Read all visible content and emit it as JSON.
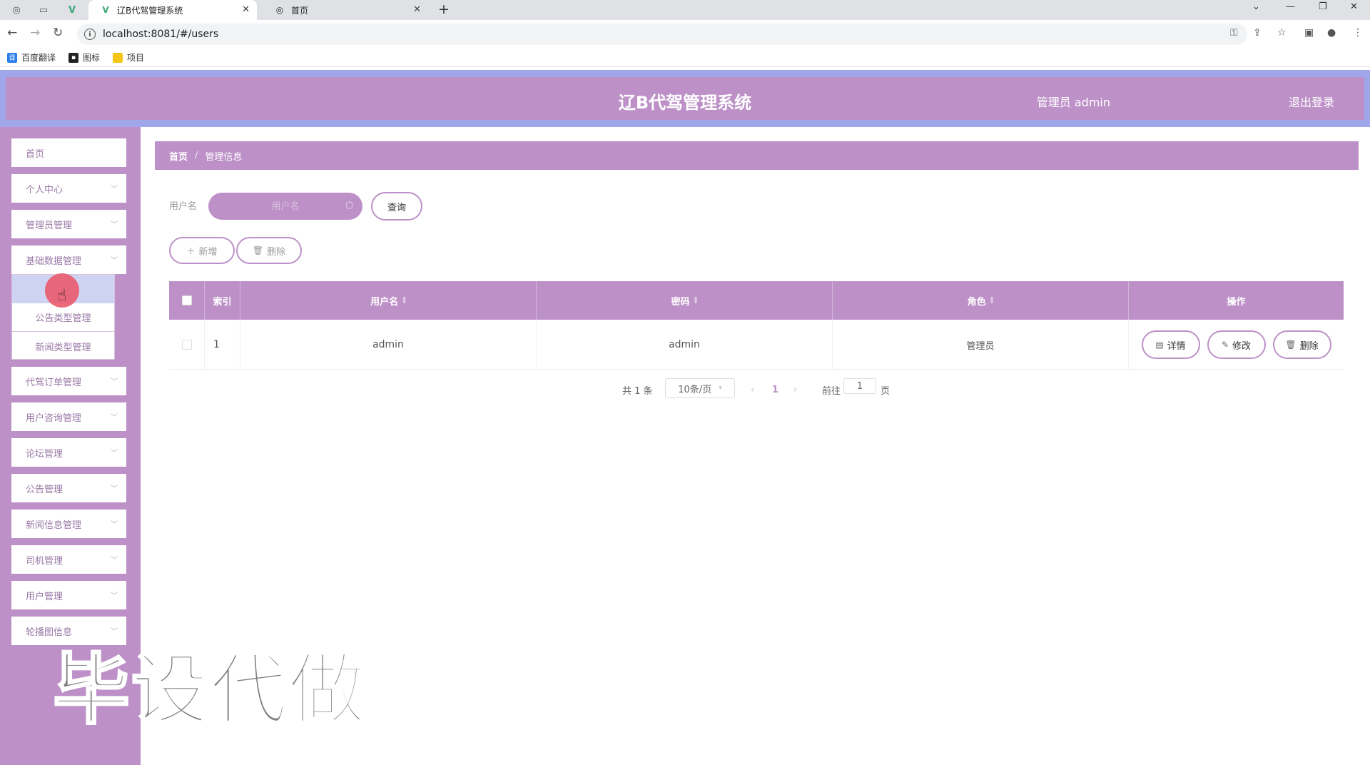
{
  "browser": {
    "tabs": [
      {
        "label": "辽B代驾管理系统",
        "active": true
      },
      {
        "label": "首页",
        "active": false
      }
    ],
    "url": "localhost:8081/#/users",
    "bookmarks": [
      "百度翻译",
      "图标",
      "项目"
    ]
  },
  "header": {
    "title": "辽B代驾管理系统",
    "user": "管理员 admin",
    "logout": "退出登录"
  },
  "sidebar": {
    "items": [
      {
        "label": "首页",
        "expandable": false
      },
      {
        "label": "个人中心",
        "expandable": true
      },
      {
        "label": "管理员管理",
        "expandable": true
      },
      {
        "label": "基础数据管理",
        "expandable": true
      },
      {
        "label": "代驾订单管理",
        "expandable": true
      },
      {
        "label": "用户咨询管理",
        "expandable": true
      },
      {
        "label": "论坛管理",
        "expandable": true
      },
      {
        "label": "公告管理",
        "expandable": true
      },
      {
        "label": "新闻信息管理",
        "expandable": true
      },
      {
        "label": "司机管理",
        "expandable": true
      },
      {
        "label": "用户管理",
        "expandable": true
      },
      {
        "label": "轮播图信息",
        "expandable": true
      }
    ],
    "submenu": [
      "",
      "公告类型管理",
      "新闻类型管理"
    ]
  },
  "breadcrumb": [
    "首页",
    "管理信息"
  ],
  "search": {
    "label": "用户名",
    "placeholder": "用户名",
    "query_button": "查询"
  },
  "actions": {
    "add": "新增",
    "delete": "删除"
  },
  "table": {
    "headers": [
      "索引",
      "用户名",
      "密码",
      "角色",
      "操作"
    ],
    "rows": [
      {
        "index": "1",
        "username": "admin",
        "password": "admin",
        "role": "管理员"
      }
    ],
    "row_actions": [
      "详情",
      "修改",
      "删除"
    ]
  },
  "pagination": {
    "total": "共 1 条",
    "page_size": "10条/页",
    "current": "1",
    "goto_label": "前往",
    "goto_value": "1",
    "page_suffix": "页"
  },
  "watermark": "毕设代做",
  "colors": {
    "primary": "#bd91c8",
    "header_border": "#9fa7ea",
    "highlight": "#cfd3f3",
    "click_marker": "#ea5a6c"
  }
}
